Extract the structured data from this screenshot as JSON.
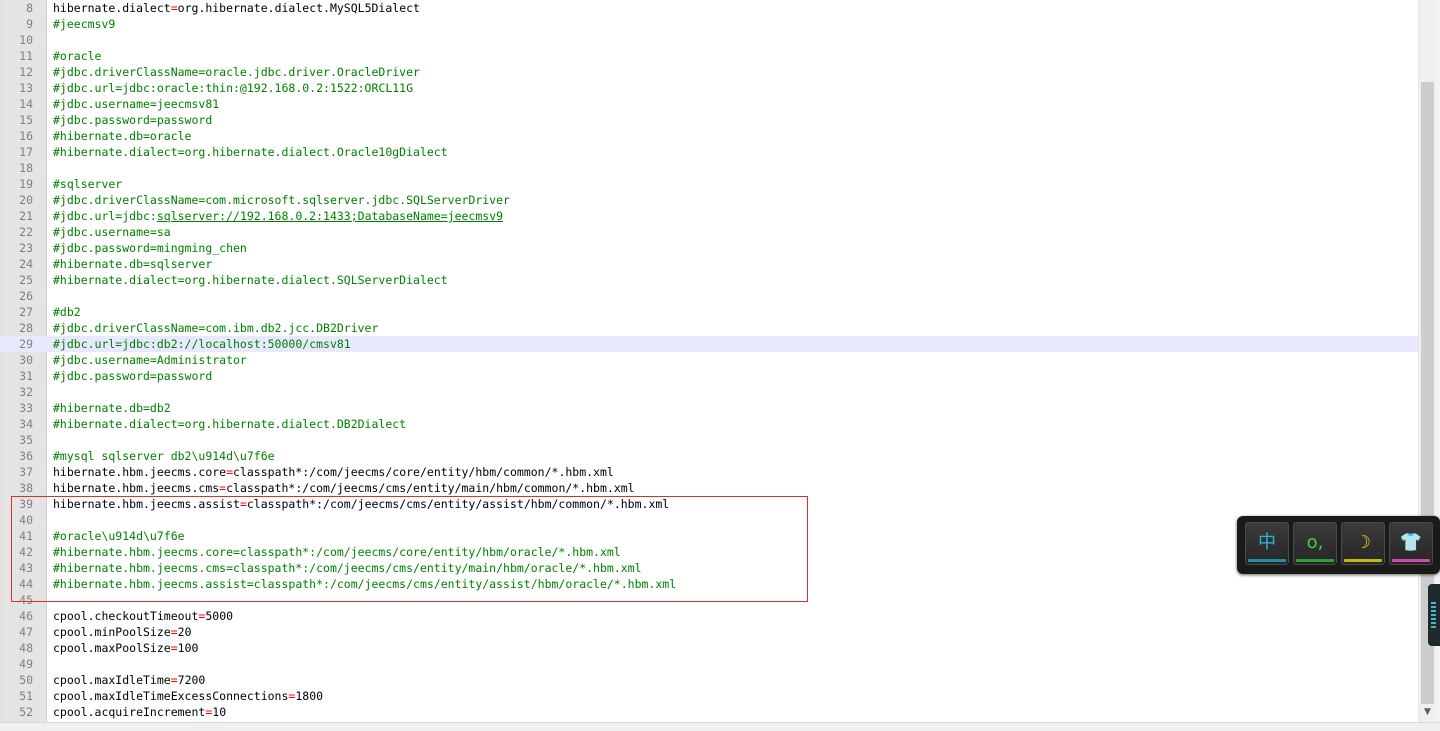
{
  "editor": {
    "current_line": "29",
    "lines": [
      {
        "n": "8",
        "parts": [
          [
            "k",
            "hibernate.dialect"
          ],
          [
            "o",
            "="
          ],
          [
            "v",
            "org.hibernate.dialect.MySQL5Dialect"
          ]
        ]
      },
      {
        "n": "9",
        "parts": [
          [
            "c",
            "#jeecmsv9"
          ]
        ]
      },
      {
        "n": "10",
        "parts": []
      },
      {
        "n": "11",
        "parts": [
          [
            "c",
            "#oracle"
          ]
        ]
      },
      {
        "n": "12",
        "parts": [
          [
            "c",
            "#jdbc.driverClassName=oracle.jdbc.driver.OracleDriver"
          ]
        ]
      },
      {
        "n": "13",
        "parts": [
          [
            "c",
            "#jdbc.url=jdbc:oracle:thin:@192.168.0.2:1522:ORCL11G"
          ]
        ]
      },
      {
        "n": "14",
        "parts": [
          [
            "c",
            "#jdbc.username=jeecmsv81"
          ]
        ]
      },
      {
        "n": "15",
        "parts": [
          [
            "c",
            "#jdbc.password=password"
          ]
        ]
      },
      {
        "n": "16",
        "parts": [
          [
            "c",
            "#hibernate.db=oracle"
          ]
        ]
      },
      {
        "n": "17",
        "parts": [
          [
            "c",
            "#hibernate.dialect=org.hibernate.dialect.Oracle10gDialect"
          ]
        ]
      },
      {
        "n": "18",
        "parts": []
      },
      {
        "n": "19",
        "parts": [
          [
            "c",
            "#sqlserver"
          ]
        ]
      },
      {
        "n": "20",
        "parts": [
          [
            "c",
            "#jdbc.driverClassName=com.microsoft.sqlserver.jdbc.SQLServerDriver"
          ]
        ]
      },
      {
        "n": "21",
        "parts": [
          [
            "c",
            "#jdbc.url=jdbc:"
          ],
          [
            "u",
            "sqlserver://192.168.0.2:1433;DatabaseName=jeecmsv9"
          ]
        ]
      },
      {
        "n": "22",
        "parts": [
          [
            "c",
            "#jdbc.username=sa"
          ]
        ]
      },
      {
        "n": "23",
        "parts": [
          [
            "c",
            "#jdbc.password=mingming_chen"
          ]
        ]
      },
      {
        "n": "24",
        "parts": [
          [
            "c",
            "#hibernate.db=sqlserver"
          ]
        ]
      },
      {
        "n": "25",
        "parts": [
          [
            "c",
            "#hibernate.dialect=org.hibernate.dialect.SQLServerDialect"
          ]
        ]
      },
      {
        "n": "26",
        "parts": []
      },
      {
        "n": "27",
        "parts": [
          [
            "c",
            "#db2"
          ]
        ]
      },
      {
        "n": "28",
        "parts": [
          [
            "c",
            "#jdbc.driverClassName=com.ibm.db2.jcc.DB2Driver"
          ]
        ]
      },
      {
        "n": "29",
        "parts": [
          [
            "c",
            "#jdbc.url=jdbc:db2://localhost:50000/cmsv81"
          ]
        ]
      },
      {
        "n": "30",
        "parts": [
          [
            "c",
            "#jdbc.username=Administrator"
          ]
        ]
      },
      {
        "n": "31",
        "parts": [
          [
            "c",
            "#jdbc.password=password"
          ]
        ]
      },
      {
        "n": "32",
        "parts": []
      },
      {
        "n": "33",
        "parts": [
          [
            "c",
            "#hibernate.db=db2"
          ]
        ]
      },
      {
        "n": "34",
        "parts": [
          [
            "c",
            "#hibernate.dialect=org.hibernate.dialect.DB2Dialect"
          ]
        ]
      },
      {
        "n": "35",
        "parts": []
      },
      {
        "n": "36",
        "parts": [
          [
            "c",
            "#mysql sqlserver db2\\u914d\\u7f6e"
          ]
        ]
      },
      {
        "n": "37",
        "parts": [
          [
            "k",
            "hibernate.hbm.jeecms.core"
          ],
          [
            "o",
            "="
          ],
          [
            "v",
            "classpath*:/com/jeecms/core/entity/hbm/common/*.hbm.xml"
          ]
        ]
      },
      {
        "n": "38",
        "parts": [
          [
            "k",
            "hibernate.hbm.jeecms.cms"
          ],
          [
            "o",
            "="
          ],
          [
            "v",
            "classpath*:/com/jeecms/cms/entity/main/hbm/common/*.hbm.xml"
          ]
        ]
      },
      {
        "n": "39",
        "parts": [
          [
            "k",
            "hibernate.hbm.jeecms.assist"
          ],
          [
            "o",
            "="
          ],
          [
            "v",
            "classpath*:/com/jeecms/cms/entity/assist/hbm/common/*.hbm.xml"
          ]
        ]
      },
      {
        "n": "40",
        "parts": []
      },
      {
        "n": "41",
        "parts": [
          [
            "c",
            "#oracle\\u914d\\u7f6e"
          ]
        ]
      },
      {
        "n": "42",
        "parts": [
          [
            "c",
            "#hibernate.hbm.jeecms.core=classpath*:/com/jeecms/core/entity/hbm/oracle/*.hbm.xml"
          ]
        ]
      },
      {
        "n": "43",
        "parts": [
          [
            "c",
            "#hibernate.hbm.jeecms.cms=classpath*:/com/jeecms/cms/entity/main/hbm/oracle/*.hbm.xml"
          ]
        ]
      },
      {
        "n": "44",
        "parts": [
          [
            "c",
            "#hibernate.hbm.jeecms.assist=classpath*:/com/jeecms/cms/entity/assist/hbm/oracle/*.hbm.xml"
          ]
        ]
      },
      {
        "n": "45",
        "parts": []
      },
      {
        "n": "46",
        "parts": [
          [
            "k",
            "cpool.checkoutTimeout"
          ],
          [
            "o",
            "="
          ],
          [
            "v",
            "5000"
          ]
        ]
      },
      {
        "n": "47",
        "parts": [
          [
            "k",
            "cpool.minPoolSize"
          ],
          [
            "o",
            "="
          ],
          [
            "v",
            "20"
          ]
        ]
      },
      {
        "n": "48",
        "parts": [
          [
            "k",
            "cpool.maxPoolSize"
          ],
          [
            "o",
            "="
          ],
          [
            "v",
            "100"
          ]
        ]
      },
      {
        "n": "49",
        "parts": []
      },
      {
        "n": "50",
        "parts": [
          [
            "k",
            "cpool.maxIdleTime"
          ],
          [
            "o",
            "="
          ],
          [
            "v",
            "7200"
          ]
        ]
      },
      {
        "n": "51",
        "parts": [
          [
            "k",
            "cpool.maxIdleTimeExcessConnections"
          ],
          [
            "o",
            "="
          ],
          [
            "v",
            "1800"
          ]
        ]
      },
      {
        "n": "52",
        "parts": [
          [
            "k",
            "cpool.acquireIncrement"
          ],
          [
            "o",
            "="
          ],
          [
            "v",
            "10"
          ]
        ]
      }
    ]
  },
  "ime_toolbar": {
    "buttons": [
      {
        "name": "ime-chinese-mode-button",
        "glyph": "中",
        "color": "#26b8d4",
        "underline": "#1e8fa5"
      },
      {
        "name": "ime-punctuation-button",
        "glyph": "o,",
        "color": "#3fd24a",
        "underline": "#2aa036"
      },
      {
        "name": "ime-halfwidth-moon-button",
        "glyph": "☽",
        "color": "#e8d21a",
        "underline": "#c7b21a"
      },
      {
        "name": "ime-skin-shirt-button",
        "glyph": "👕",
        "color": "#30c7d8",
        "underline": "#d04ab0"
      }
    ]
  },
  "colors": {
    "comment": "#008000",
    "operator": "#ff0000",
    "line_number": "#808080",
    "current_line_bg": "#e8e8ff",
    "highlight_box": "#d93030"
  },
  "icons": {
    "scroll_down": "chevron-down-icon"
  }
}
